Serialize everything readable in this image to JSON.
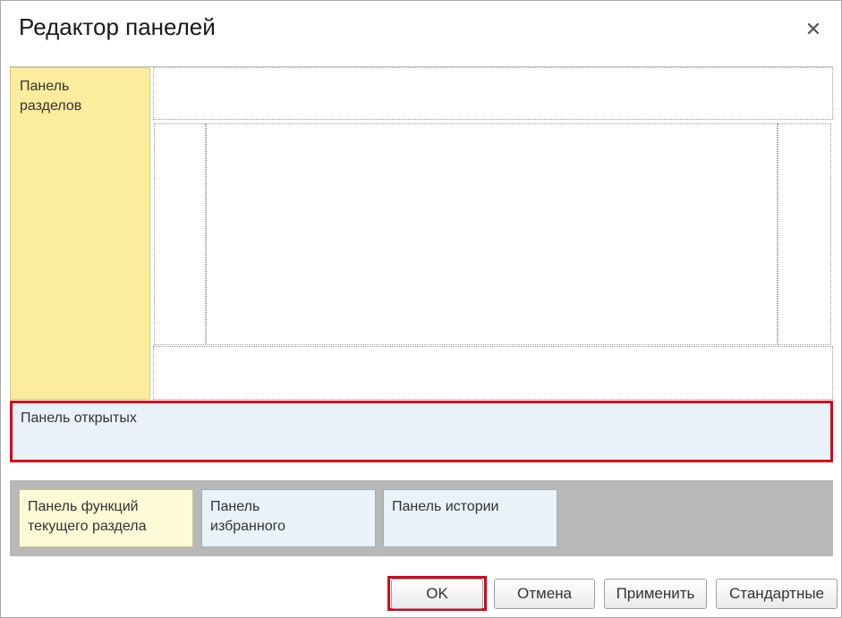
{
  "dialog": {
    "title": "Редактор панелей",
    "close_icon": "close-icon"
  },
  "layout": {
    "sections_panel_label": "Панель\nразделов",
    "open_panel_label": "Панель открытых"
  },
  "unused_panels": [
    {
      "label": "Панель функций\nтекущего раздела",
      "color": "#fdfbd6"
    },
    {
      "label": "Панель\nизбранного",
      "color": "#e8f2f8"
    },
    {
      "label": "Панель истории",
      "color": "#e8f2f8"
    }
  ],
  "buttons": {
    "ok": "OK",
    "cancel": "Отмена",
    "apply": "Применить",
    "standard": "Стандартные"
  },
  "colors": {
    "highlight": "#d6001c",
    "sections_panel": "#fcec9e",
    "open_panel": "#e8f2f8",
    "unused_area": "#b8b8b8"
  }
}
